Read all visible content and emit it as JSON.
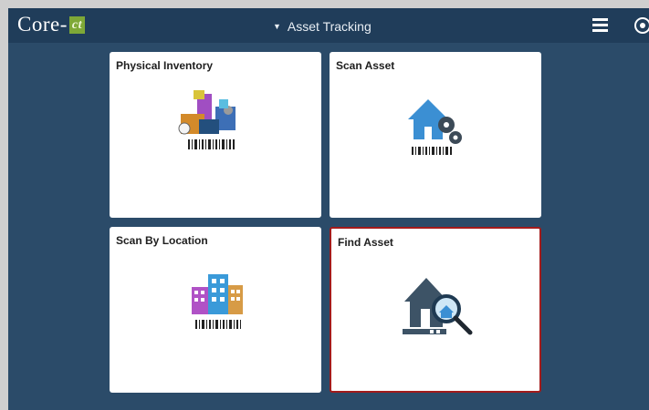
{
  "header": {
    "logo_text": "Core-",
    "logo_badge": "ct",
    "title": "Asset Tracking",
    "caret_icon": "triangle-down",
    "menu_icon": "hamburger-menu-icon",
    "nav_icon": "navbar-compass-icon"
  },
  "tiles": [
    {
      "label": "Physical Inventory",
      "icon": "physical-inventory-icon",
      "selected": false
    },
    {
      "label": "Scan Asset",
      "icon": "scan-asset-icon",
      "selected": false
    },
    {
      "label": "Scan By Location",
      "icon": "scan-by-location-icon",
      "selected": false
    },
    {
      "label": "Find Asset",
      "icon": "find-asset-icon",
      "selected": true
    }
  ],
  "colors": {
    "background": "#2b4b69",
    "header": "#203d5a",
    "tile": "#ffffff",
    "selected_border": "#a31b1b",
    "logo_badge": "#7ea837"
  }
}
